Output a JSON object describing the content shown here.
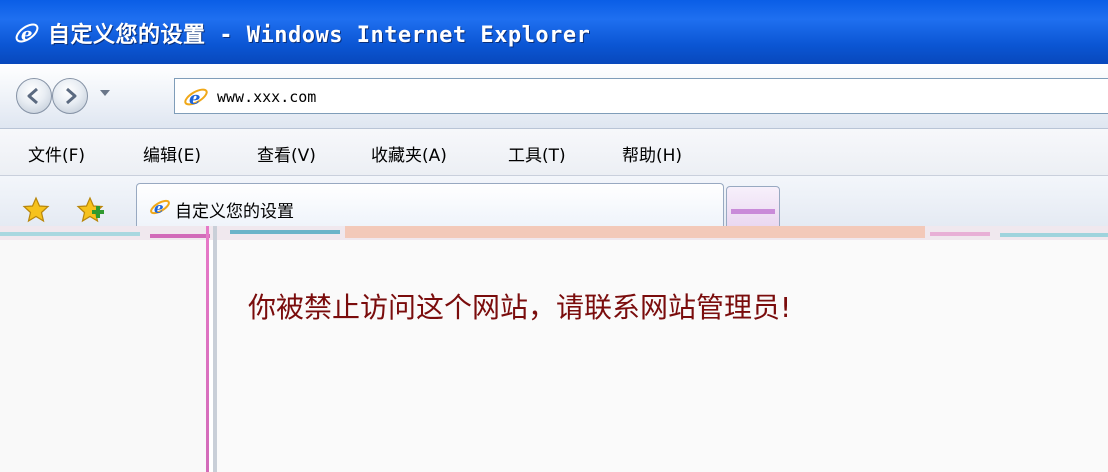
{
  "window": {
    "title": "自定义您的设置 - Windows Internet Explorer"
  },
  "address_bar": {
    "url": "www.xxx.com"
  },
  "menu": {
    "items": [
      "文件(F)",
      "编辑(E)",
      "查看(V)",
      "收藏夹(A)",
      "工具(T)",
      "帮助(H)"
    ]
  },
  "tabs": {
    "active_label": "自定义您的设置"
  },
  "page": {
    "message": "你被禁止访问这个网站，请联系网站管理员!"
  },
  "colors": {
    "titlebar": "#0a5ee6",
    "message_text": "#7a0c0c",
    "divider_accent": "#e779c8"
  }
}
